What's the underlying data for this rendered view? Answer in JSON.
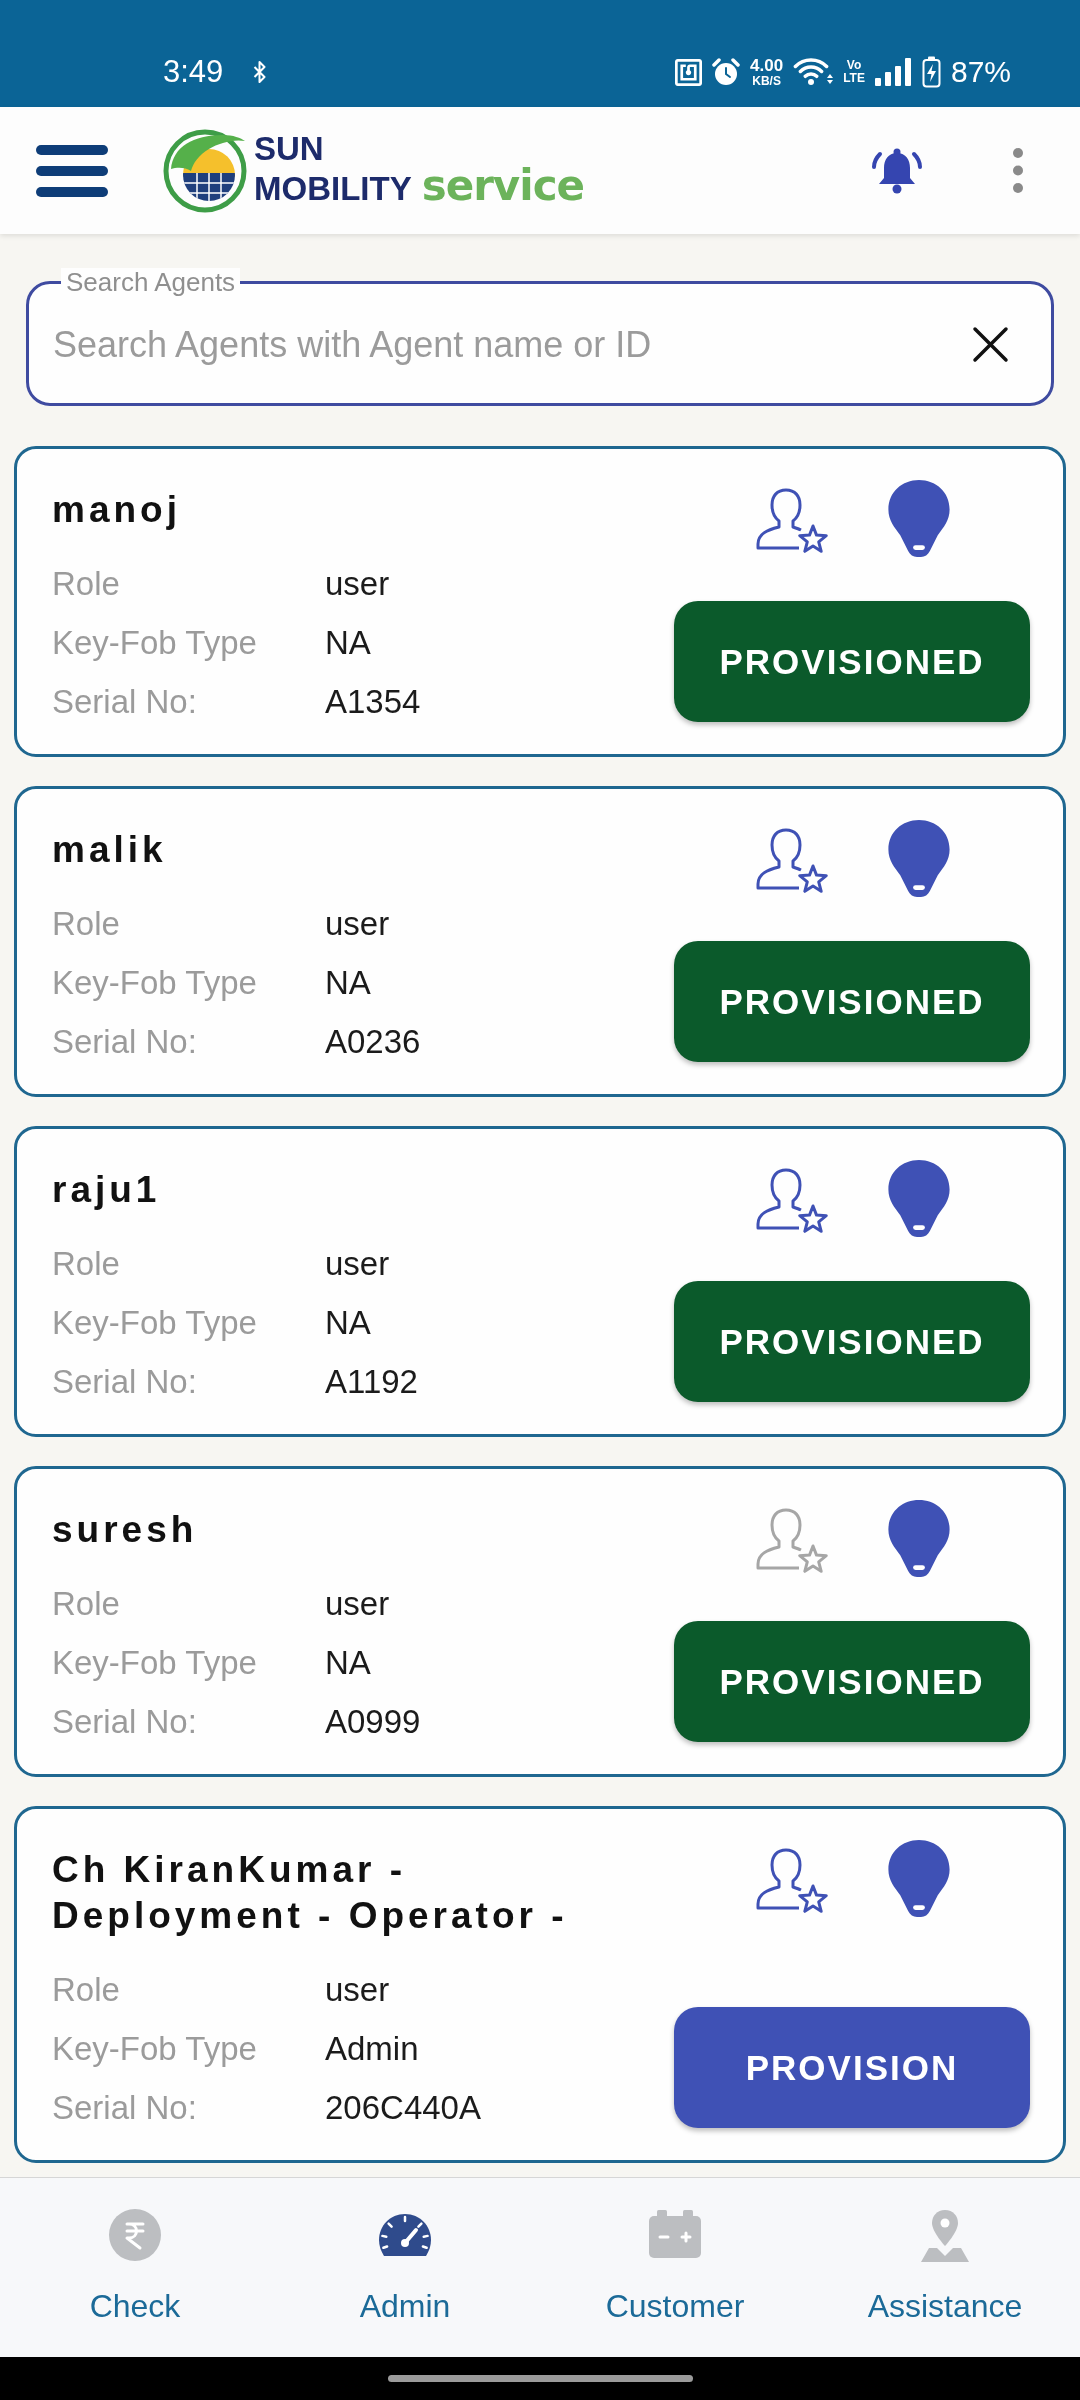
{
  "status_bar": {
    "time": "3:49",
    "speed": "4.00",
    "speed_unit": "KB/S",
    "volte_line_1": "Vo",
    "volte_line_2": "LTE",
    "battery": "87%"
  },
  "header": {
    "logo": {
      "name_line_1": "SUN",
      "name_line_2": "MOBILITY",
      "tagline": "service"
    }
  },
  "search": {
    "label": "Search Agents",
    "placeholder": "Search Agents with Agent name or ID"
  },
  "agents": [
    {
      "name": "manoj",
      "user_icon_active": true,
      "fields": [
        {
          "label": "Role",
          "value": "user"
        },
        {
          "label": "Key-Fob Type",
          "value": "NA"
        },
        {
          "label": "Serial No:",
          "value": "A1354"
        }
      ],
      "provisioned": true,
      "button": "PROVISIONED"
    },
    {
      "name": "malik",
      "user_icon_active": true,
      "fields": [
        {
          "label": "Role",
          "value": "user"
        },
        {
          "label": "Key-Fob Type",
          "value": "NA"
        },
        {
          "label": "Serial No:",
          "value": "A0236"
        }
      ],
      "provisioned": true,
      "button": "PROVISIONED"
    },
    {
      "name": "raju1",
      "user_icon_active": true,
      "fields": [
        {
          "label": "Role",
          "value": "user"
        },
        {
          "label": "Key-Fob Type",
          "value": "NA"
        },
        {
          "label": "Serial No:",
          "value": "A1192"
        }
      ],
      "provisioned": true,
      "button": "PROVISIONED"
    },
    {
      "name": "suresh",
      "user_icon_active": false,
      "fields": [
        {
          "label": "Role",
          "value": "user"
        },
        {
          "label": "Key-Fob Type",
          "value": "NA"
        },
        {
          "label": "Serial No:",
          "value": "A0999"
        }
      ],
      "provisioned": true,
      "button": "PROVISIONED"
    },
    {
      "name": "Ch KiranKumar - Deployment - Operator -",
      "user_icon_active": true,
      "fields": [
        {
          "label": "Role",
          "value": "user"
        },
        {
          "label": "Key-Fob Type",
          "value": "Admin"
        },
        {
          "label": "Serial No:",
          "value": "206C440A"
        }
      ],
      "provisioned": false,
      "button": "PROVISION"
    }
  ],
  "bottom_nav": [
    {
      "label": "Check",
      "selected": false
    },
    {
      "label": "Admin",
      "selected": true
    },
    {
      "label": "Customer",
      "selected": false
    },
    {
      "label": "Assistance",
      "selected": false
    }
  ]
}
